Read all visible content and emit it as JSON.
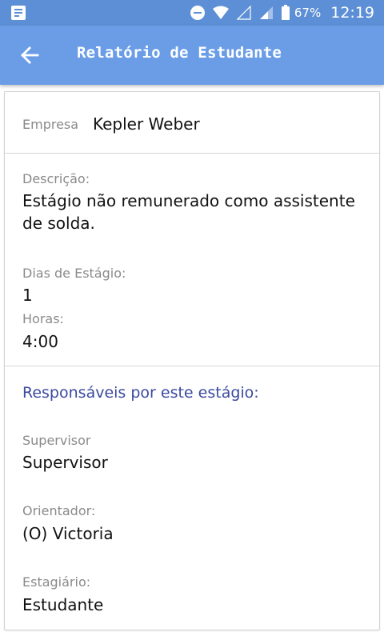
{
  "status_bar": {
    "battery": "67%",
    "time": "12:19"
  },
  "app_bar": {
    "title": "Relatório de Estudante"
  },
  "company": {
    "label": "Empresa",
    "value": "Kepler Weber"
  },
  "description": {
    "label": "Descrição:",
    "value": "Estágio não remunerado como assistente de solda."
  },
  "internship_days": {
    "label": "Dias de Estágio:",
    "value": "1"
  },
  "hours": {
    "label": "Horas:",
    "value": "4:00"
  },
  "responsibles": {
    "title": "Responsáveis por este estágio:",
    "supervisor": {
      "label": "Supervisor",
      "value": "Supervisor"
    },
    "advisor": {
      "label": "Orientador:",
      "value": "(O) Victoria"
    },
    "intern": {
      "label": "Estagiário:",
      "value": "Estudante"
    }
  },
  "colors": {
    "status_bar": "#5d8fd6",
    "app_bar": "#6a9de6",
    "section_title": "#3b4a9e"
  },
  "icons": {
    "back": "arrow-left-icon",
    "notification": "notification-icon",
    "dnd": "do-not-disturb-icon",
    "wifi": "wifi-icon",
    "signal": "signal-icon",
    "battery": "battery-icon"
  }
}
